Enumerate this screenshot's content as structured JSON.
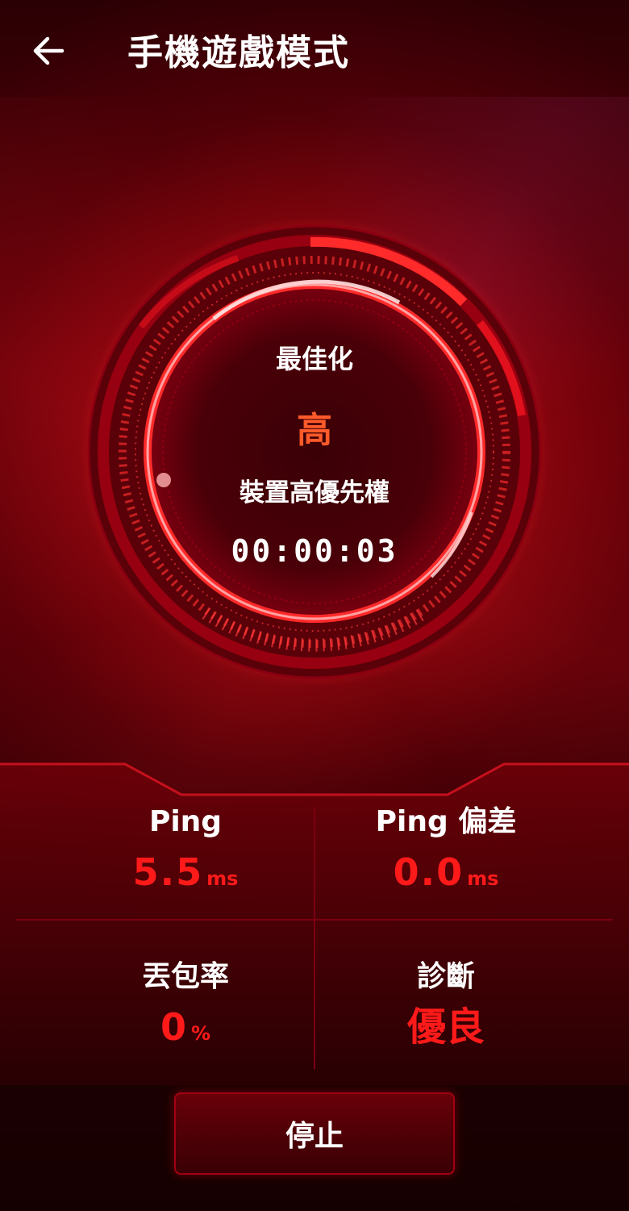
{
  "header": {
    "title": "手機遊戲模式",
    "back_icon": "arrow-left-icon"
  },
  "status": {
    "optimize_label": "最佳化",
    "priority_level": "高",
    "priority_label": "裝置高優先權",
    "elapsed_time": "00:00:03"
  },
  "stats": {
    "ping": {
      "label": "Ping",
      "value": "5.5",
      "unit": "ms"
    },
    "ping_deviation": {
      "label": "Ping 偏差",
      "value": "0.0",
      "unit": "ms"
    },
    "packet_loss": {
      "label": "丟包率",
      "value": "0",
      "unit": "%"
    },
    "diagnosis": {
      "label": "診斷",
      "value": "優良"
    }
  },
  "actions": {
    "stop_label": "停止"
  },
  "colors": {
    "accent_red": "#ff1a1a",
    "priority_orange": "#ff5a2a",
    "background_dark": "#180000"
  }
}
